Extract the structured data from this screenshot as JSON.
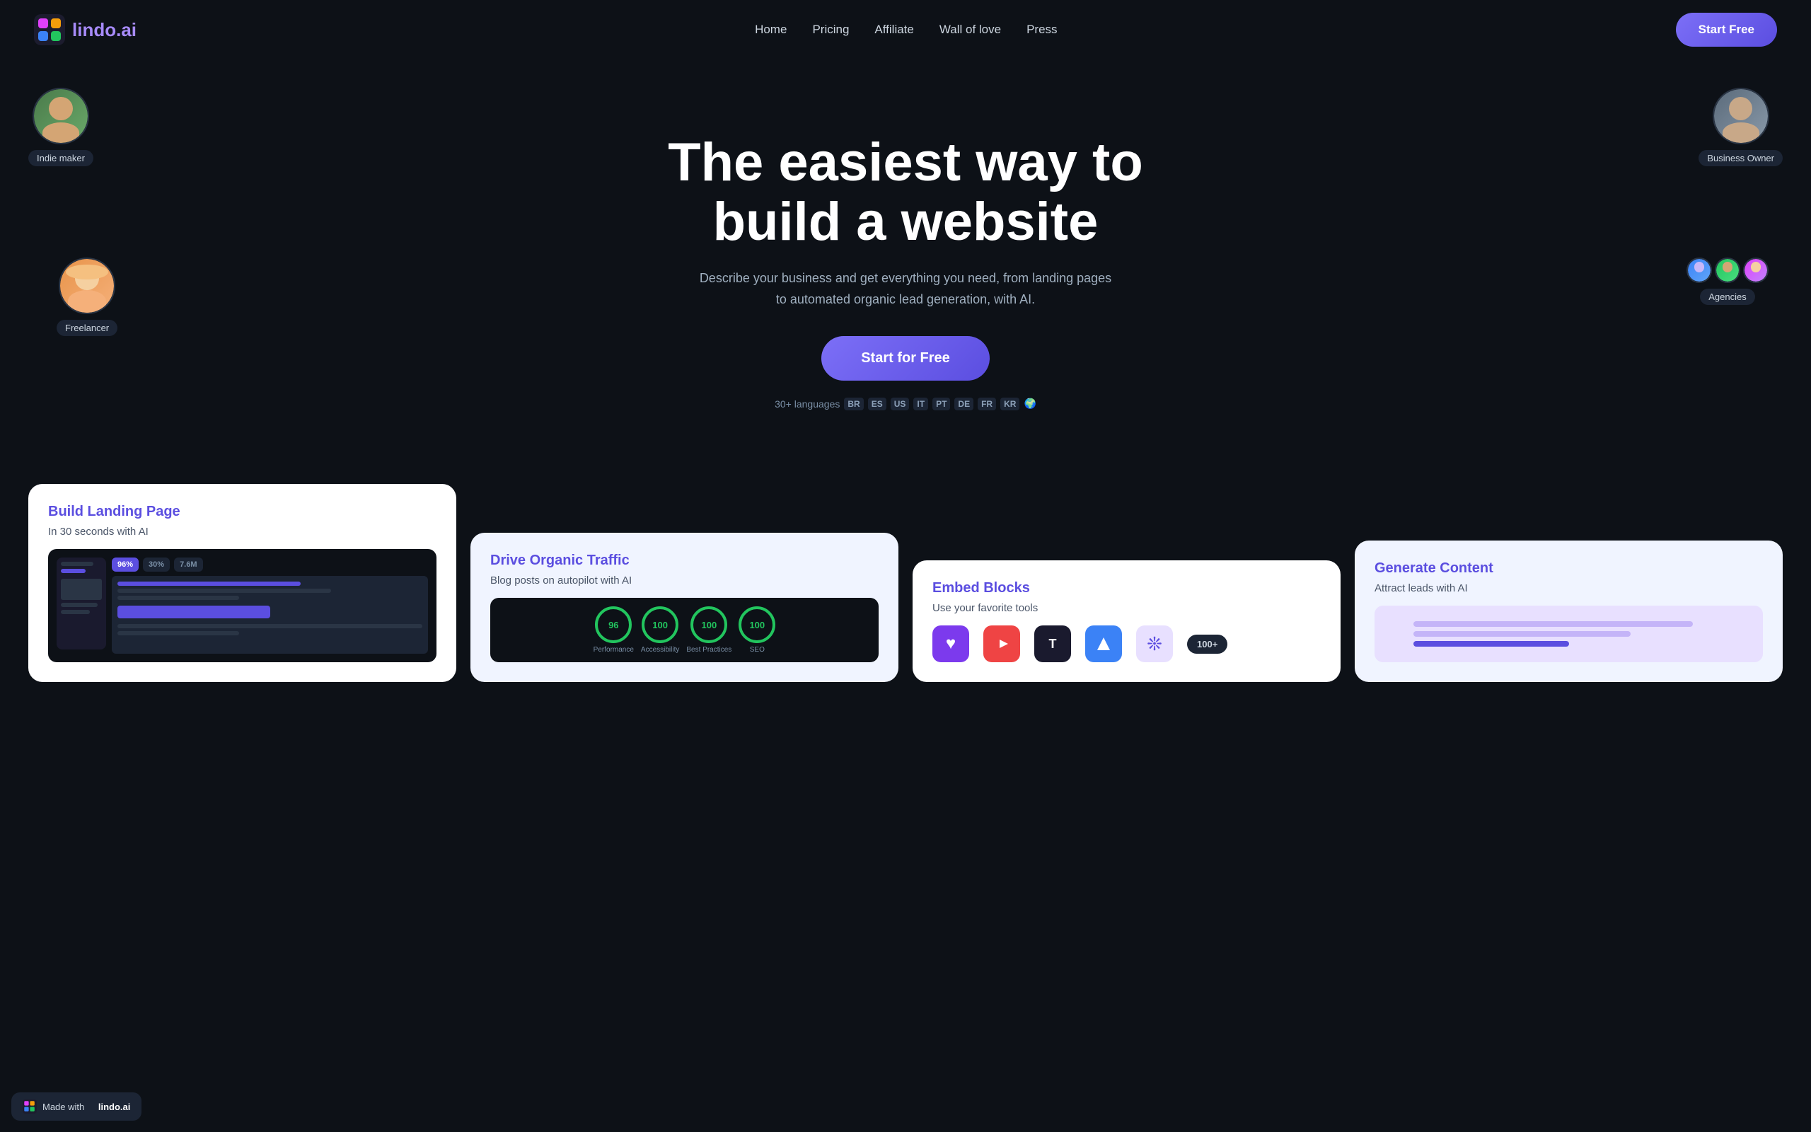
{
  "nav": {
    "logo_text": "lindo",
    "logo_suffix": ".ai",
    "links": [
      {
        "label": "Home",
        "id": "home"
      },
      {
        "label": "Pricing",
        "id": "pricing"
      },
      {
        "label": "Affiliate",
        "id": "affiliate"
      },
      {
        "label": "Wall of love",
        "id": "wall-of-love"
      },
      {
        "label": "Press",
        "id": "press"
      }
    ],
    "cta_label": "Start Free"
  },
  "hero": {
    "heading_line1": "The easiest way to",
    "heading_line2": "build a website",
    "subtext": "Describe your business and get everything you need, from landing pages to automated organic lead generation, with AI.",
    "cta_label": "Start for Free",
    "languages_prefix": "30+ languages",
    "languages": [
      "BR",
      "ES",
      "US",
      "IT",
      "PT",
      "DE",
      "FR",
      "KR"
    ]
  },
  "personas": [
    {
      "id": "indie-maker",
      "label": "Indie maker",
      "position": "top-left"
    },
    {
      "id": "freelancer",
      "label": "Freelancer",
      "position": "mid-left"
    },
    {
      "id": "business-owner",
      "label": "Business Owner",
      "position": "top-right"
    },
    {
      "id": "agencies",
      "label": "Agencies",
      "position": "mid-right"
    }
  ],
  "feature_cards": [
    {
      "id": "build-landing-page",
      "title": "Build Landing Page",
      "subtitle": "In 30 seconds with AI",
      "stats": [
        "96%",
        "30%",
        "7.6M"
      ]
    },
    {
      "id": "drive-organic-traffic",
      "title": "Drive Organic Traffic",
      "subtitle": "Blog posts on autopilot with AI",
      "scores": [
        {
          "value": "96",
          "label": "Performance",
          "color": "green"
        },
        {
          "value": "100",
          "label": "Accessibility",
          "color": "green"
        },
        {
          "value": "100",
          "label": "Best Practices",
          "color": "green"
        },
        {
          "value": "100",
          "label": "SEO",
          "color": "green"
        }
      ]
    },
    {
      "id": "embed-blocks",
      "title": "Embed Blocks",
      "subtitle": "Use your favorite tools",
      "more_count": "100+"
    },
    {
      "id": "generate-content",
      "title": "Generate Content",
      "subtitle": "Attract leads with AI"
    }
  ],
  "footer_badge": {
    "prefix": "Made with",
    "brand": "lindo.ai"
  }
}
